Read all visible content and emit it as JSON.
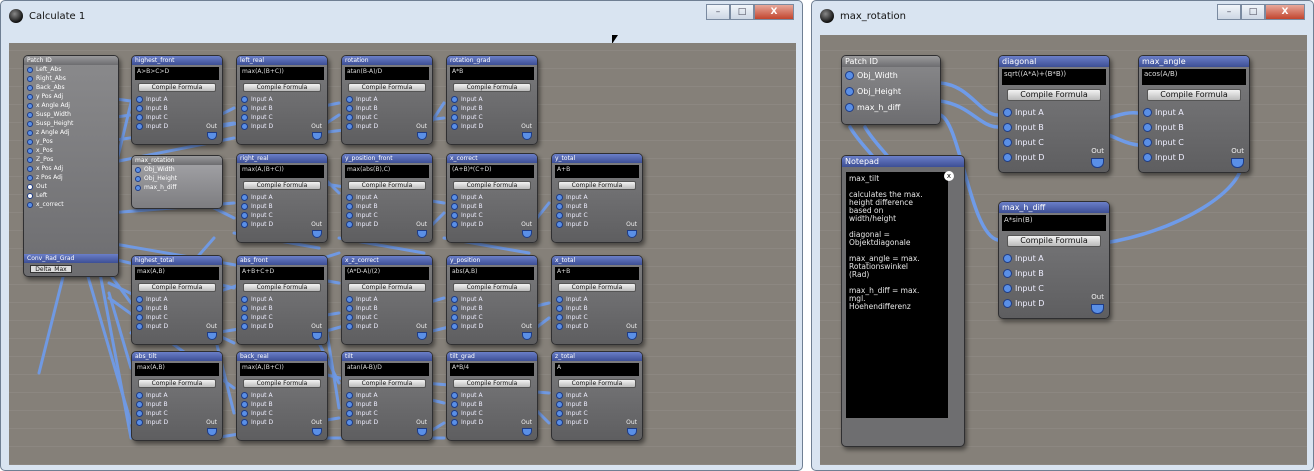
{
  "cursor": "mouse-cursor",
  "left_window": {
    "title": "Calculate 1",
    "controls": {
      "minimize": "–",
      "maximize": "□",
      "close": "X"
    },
    "patch_panel": {
      "title": "Patch ID",
      "items": [
        "Left_Abs",
        "Right_Abs",
        "Back_Abs",
        "y Pos Adj",
        "x Angle Adj",
        "Susp_Width",
        "Susp_Height",
        "z Angle Adj",
        "y_Pos",
        "x_Pos",
        "Z_Pos",
        "x Pos Adj",
        "z Pos Adj",
        "Out",
        "Left",
        "x_correct"
      ],
      "footer_title": "Conv_Rad_Grad",
      "footer_value": "Delta_Max"
    },
    "max_rotation_panel": {
      "title": "max_rotation",
      "items": [
        "Obj_Width",
        "Obj_Height",
        "max_h_diff"
      ]
    },
    "compile_label": "Compile Formula",
    "input_labels": [
      "Input A",
      "Input B",
      "Input C",
      "Input D"
    ],
    "out_label": "Out",
    "nodes": [
      {
        "title": "highest_front",
        "formula": "A>B>C>D"
      },
      {
        "title": "left_real",
        "formula": "max(A,(B+C))"
      },
      {
        "title": "rotation",
        "formula": "atan(B-A)/D"
      },
      {
        "title": "rotation_grad",
        "formula": "A*B"
      },
      {
        "title": "right_real",
        "formula": "max(A,(B+C))"
      },
      {
        "title": "y_position_front",
        "formula": "max(abs(B),C)"
      },
      {
        "title": "x_correct",
        "formula": "(A+B)*(C+D)"
      },
      {
        "title": "y_total",
        "formula": "A+B"
      },
      {
        "title": "highest_total",
        "formula": "max(A,B)"
      },
      {
        "title": "abs_front",
        "formula": "A+B+C+D"
      },
      {
        "title": "x_z_correct",
        "formula": "(A*D-A)/(2)"
      },
      {
        "title": "y_position",
        "formula": "abs(A,B)"
      },
      {
        "title": "x_total",
        "formula": "A+B"
      },
      {
        "title": "abs_tilt",
        "formula": "max(A,B)"
      },
      {
        "title": "back_real",
        "formula": "max(A,(B+C))"
      },
      {
        "title": "tilt",
        "formula": "atan(A-B)/D"
      },
      {
        "title": "tilt_grad",
        "formula": "A*B/4"
      },
      {
        "title": "z_total",
        "formula": "A"
      }
    ]
  },
  "right_window": {
    "title": "max_rotation",
    "controls": {
      "minimize": "–",
      "maximize": "□",
      "close": "X"
    },
    "patch_panel": {
      "title": "Patch ID",
      "items": [
        "Obj_Width",
        "Obj_Height",
        "max_h_diff"
      ]
    },
    "compile_label": "Compile Formula",
    "input_labels": [
      "Input A",
      "Input B",
      "Input C",
      "Input D"
    ],
    "out_label": "Out",
    "nodes": [
      {
        "title": "diagonal",
        "formula": "sqrt((A*A)+(B*B))"
      },
      {
        "title": "max_angle",
        "formula": "acos(A/B)"
      },
      {
        "title": "max_h_diff",
        "formula": "A*sin(B)"
      }
    ],
    "notepad": {
      "title": "Notepad",
      "close": "x",
      "text": "max_tilt\n\ncalculates the max.\nheight difference\nbased on\nwidth/height\n\ndiagonal =\nObjektdiagonale\n\nmax_angle = max.\nRotationswinkel\n(Rad)\n\nmax_h_diff = max.\nmgl.\nHoehendifferenz"
    }
  }
}
